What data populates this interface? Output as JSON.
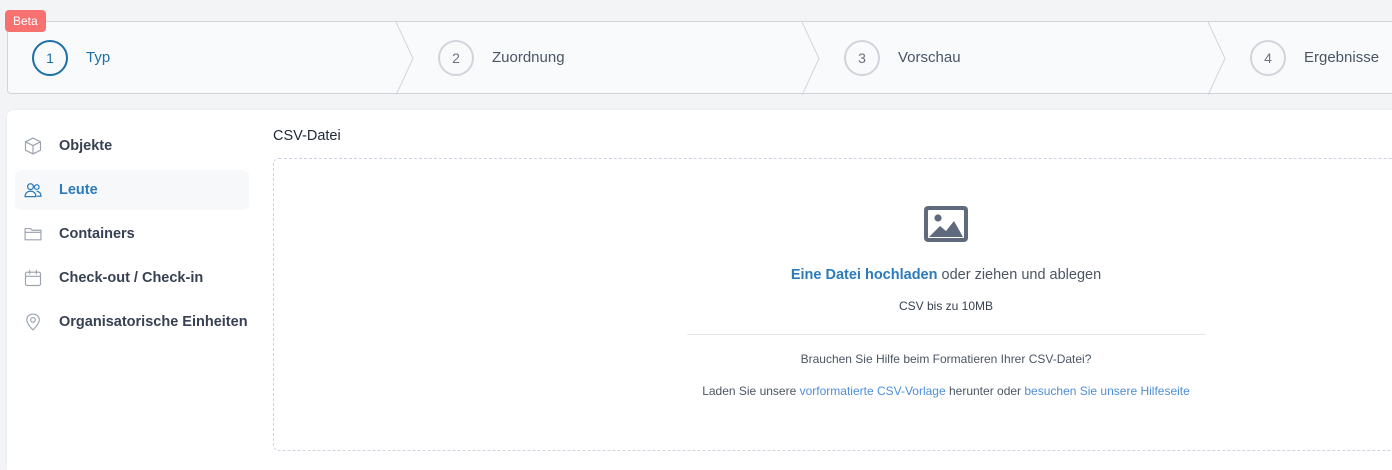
{
  "badge": {
    "label": "Beta",
    "color": "#f87171"
  },
  "steps": [
    {
      "number": "1",
      "label": "Typ",
      "active": true
    },
    {
      "number": "2",
      "label": "Zuordnung",
      "active": false
    },
    {
      "number": "3",
      "label": "Vorschau",
      "active": false
    },
    {
      "number": "4",
      "label": "Ergebnisse",
      "active": false
    }
  ],
  "sidebar": {
    "items": [
      {
        "label": "Objekte",
        "icon": "cube-icon"
      },
      {
        "label": "Leute",
        "icon": "users-icon",
        "active": true
      },
      {
        "label": "Containers",
        "icon": "folder-icon"
      },
      {
        "label": "Check-out / Check-in",
        "icon": "calendar-icon"
      },
      {
        "label": "Organisatorische Einheiten",
        "icon": "map-pin-icon"
      }
    ]
  },
  "upload": {
    "section_title": "CSV-Datei",
    "icon": "image-icon",
    "upload_link": "Eine Datei hochladen",
    "upload_rest": " oder ziehen und ablegen",
    "size_hint": "CSV bis zu 10MB",
    "help_question": "Brauchen Sie Hilfe beim Formatieren Ihrer CSV-Datei?",
    "help_prefix": "Laden Sie unsere ",
    "template_link": "vorformatierte CSV-Vorlage",
    "help_middle": " herunter oder ",
    "help_page_link": "besuchen Sie unsere Hilfeseite"
  },
  "colors": {
    "accent": "#2b7bbb",
    "active_step": "#1d6fa5",
    "link": "#4f8ed6"
  }
}
